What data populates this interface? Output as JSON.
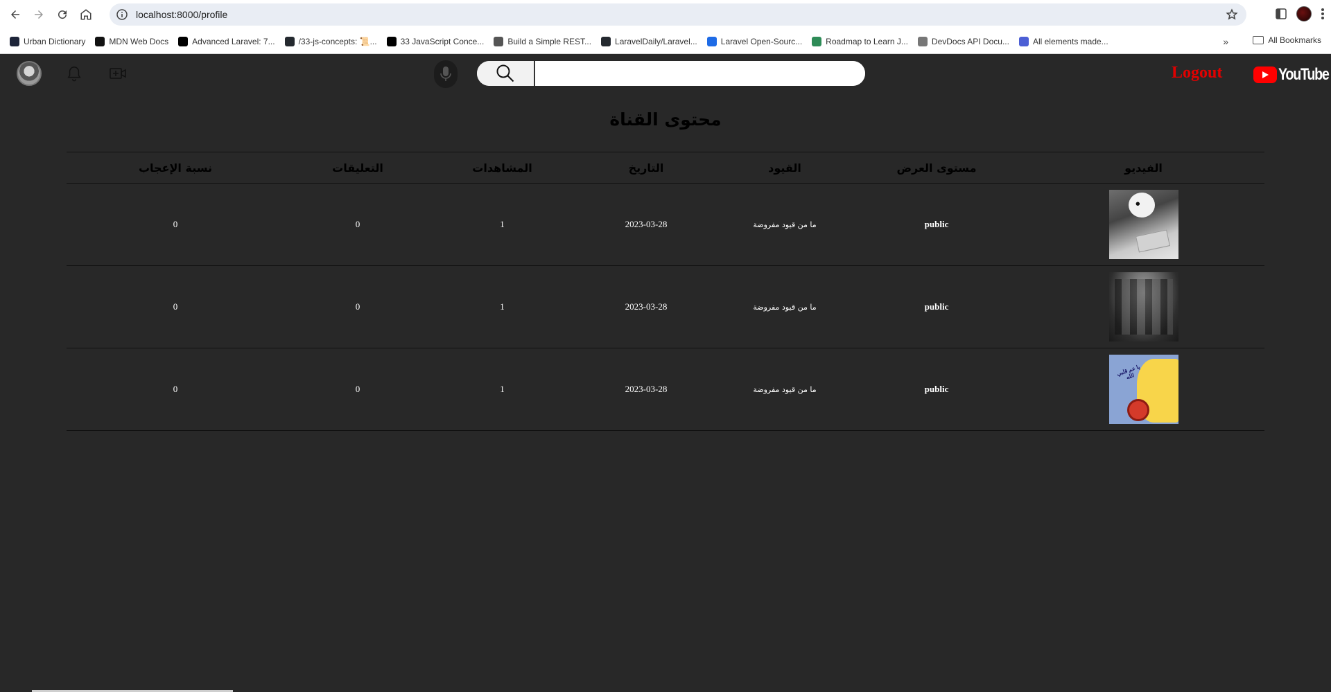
{
  "browser": {
    "url": "localhost:8000/profile",
    "bookmarks": [
      {
        "label": "Urban Dictionary",
        "icon": "urban-dictionary-icon",
        "color": "#1d2439"
      },
      {
        "label": "MDN Web Docs",
        "icon": "mdn-icon",
        "color": "#111111"
      },
      {
        "label": "Advanced Laravel: 7...",
        "icon": "medium-icon",
        "color": "#000000"
      },
      {
        "label": "/33-js-concepts: 📜...",
        "icon": "github-icon",
        "color": "#24292f"
      },
      {
        "label": "33 JavaScript Conce...",
        "icon": "dev-icon",
        "color": "#000000"
      },
      {
        "label": "Build a Simple REST...",
        "icon": "code-brackets-icon",
        "color": "#555555"
      },
      {
        "label": "LaravelDaily/Laravel...",
        "icon": "github-icon",
        "color": "#24292f"
      },
      {
        "label": "Laravel Open-Sourc...",
        "icon": "laravel-news-icon",
        "color": "#1e6be6"
      },
      {
        "label": "Roadmap to Learn J...",
        "icon": "roadmap-icon",
        "color": "#2e8b57"
      },
      {
        "label": "DevDocs API Docu...",
        "icon": "devdocs-icon",
        "color": "#777777"
      },
      {
        "label": "All elements made...",
        "icon": "ui-icon",
        "color": "#4c5fd5"
      }
    ],
    "all_bookmarks": "All Bookmarks"
  },
  "header": {
    "search_placeholder": "",
    "logout": "Logout",
    "brand": "YouTube"
  },
  "main": {
    "title": "محتوى القناة",
    "columns": [
      "الفيديو",
      "مستوى العرض",
      "القيود",
      "التاريخ",
      "المشاهدات",
      "التعليقات",
      "نسبة الإعجاب"
    ],
    "rows": [
      {
        "visibility": "public",
        "restrictions": "ما من قيود مفروضة",
        "date": "2023-03-28",
        "views": "1",
        "comments": "0",
        "like_ratio": "0"
      },
      {
        "visibility": "public",
        "restrictions": "ما من قيود مفروضة",
        "date": "2023-03-28",
        "views": "1",
        "comments": "0",
        "like_ratio": "0"
      },
      {
        "visibility": "public",
        "restrictions": "ما من قيود مفروضة",
        "date": "2023-03-28",
        "views": "1",
        "comments": "0",
        "like_ratio": "0"
      }
    ],
    "thumb3_text": "يا عم قلبي الله"
  },
  "colors": {
    "background": "#282828",
    "logout": "#e10000",
    "brand_red": "#ff0000"
  }
}
